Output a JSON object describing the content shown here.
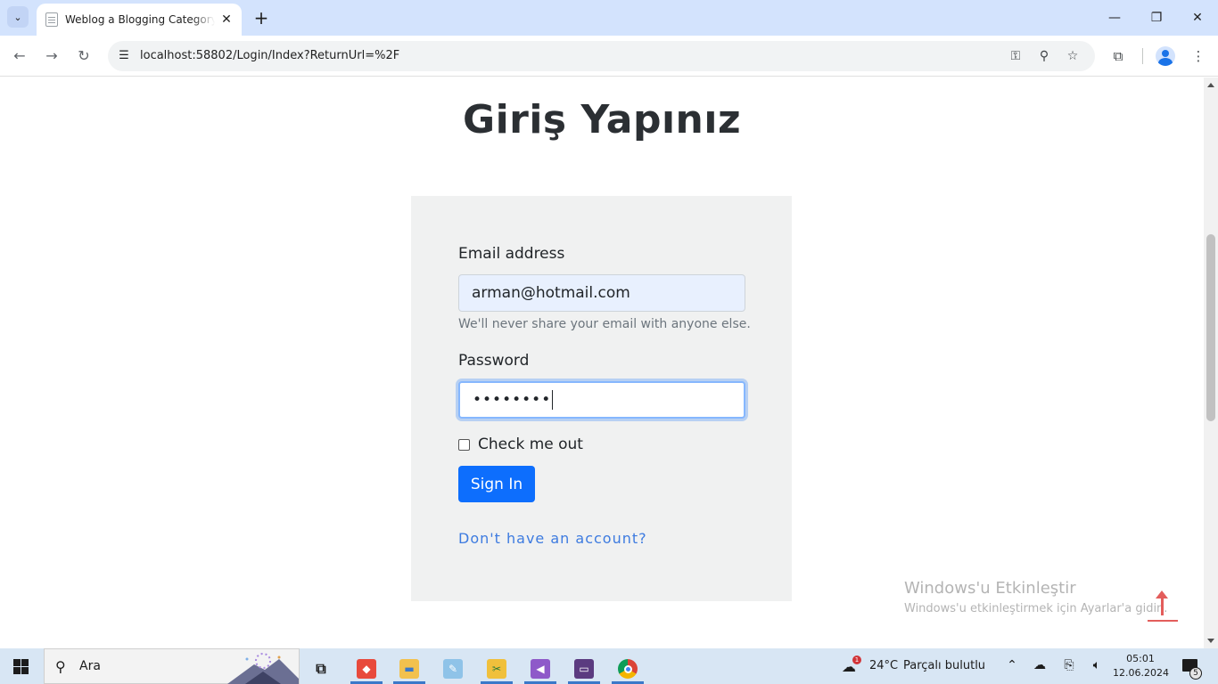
{
  "browser": {
    "tab_title": "Weblog a Blogging Category Bo",
    "url": "localhost:58802/Login/Index?ReturnUrl=%2F"
  },
  "page": {
    "heading": "Giriş Yapınız",
    "email_label": "Email address",
    "email_value": "arman@hotmail.com",
    "email_help": "We'll never share your email with anyone else.",
    "password_label": "Password",
    "password_value": "••••••••",
    "checkbox_label": "Check me out",
    "checkbox_checked": false,
    "signin_label": "Sign In",
    "register_link": "Don't have an account?"
  },
  "watermark": {
    "title": "Windows'u Etkinleştir",
    "subtitle": "Windows'u etkinleştirmek için Ayarlar'a gidin."
  },
  "taskbar": {
    "search_placeholder": "Ara",
    "weather_temp": "24°C",
    "weather_desc": "Parçalı bulutlu",
    "weather_badge": "1",
    "time": "05:01",
    "date": "12.06.2024",
    "notification_count": "5"
  },
  "colors": {
    "accent": "#0d6efd",
    "link": "#3d7be0",
    "card_bg": "#f0f1f1",
    "tabstrip": "#d3e3fd"
  }
}
